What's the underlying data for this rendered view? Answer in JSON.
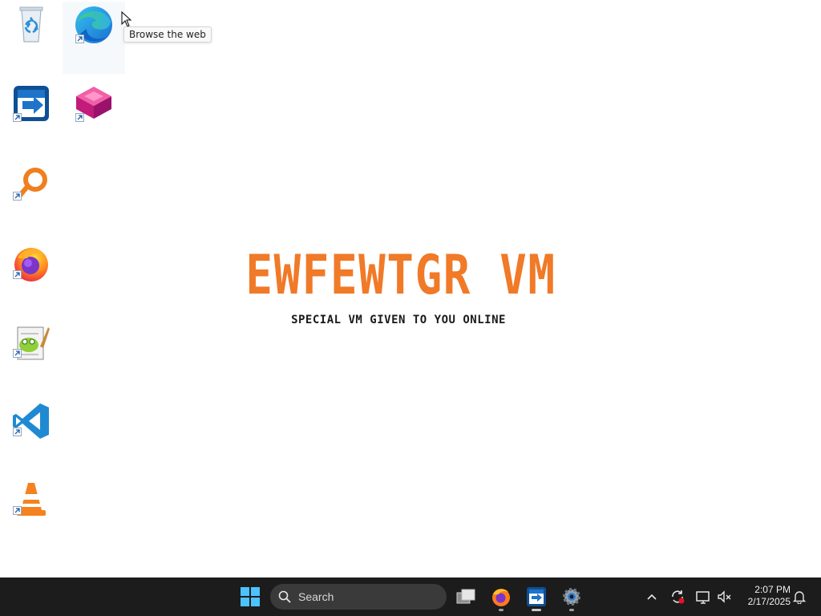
{
  "desktop": {
    "icons": [
      {
        "name": "recycle-bin",
        "shortcut": false
      },
      {
        "name": "microsoft-edge",
        "shortcut": true
      },
      {
        "name": "remote-desktop-app",
        "shortcut": true
      },
      {
        "name": "pink-cube-app",
        "shortcut": true
      },
      {
        "name": "search-magnifier-app",
        "shortcut": true
      },
      {
        "name": "firefox",
        "shortcut": true
      },
      {
        "name": "notepad-plus-plus",
        "shortcut": true
      },
      {
        "name": "visual-studio-code",
        "shortcut": true
      },
      {
        "name": "vlc-media-player",
        "shortcut": true
      }
    ],
    "tooltip": "Browse the web"
  },
  "wallpaper": {
    "title": "EWFEWTGR VM",
    "subtitle": "SPECIAL VM GIVEN TO YOU ONLINE",
    "title_color": "#f07a28"
  },
  "taskbar": {
    "search_placeholder": "Search",
    "apps": [
      "start-icon",
      "task-view-icon",
      "firefox-icon",
      "remote-desktop-icon",
      "settings-icon"
    ],
    "tray_icons": [
      "chevron-up-icon",
      "sync-icon",
      "display-icon",
      "volume-muted-icon"
    ],
    "time": "2:07 PM",
    "date": "2/17/2025"
  }
}
